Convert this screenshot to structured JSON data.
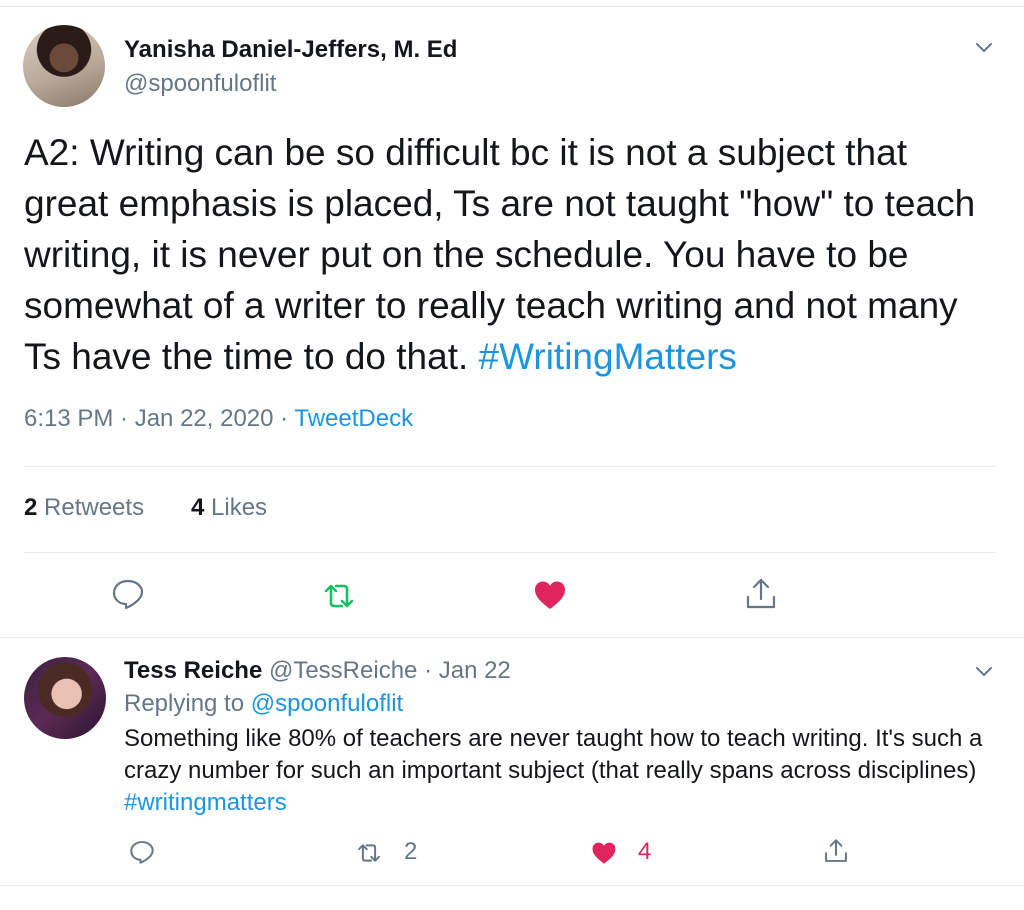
{
  "tweet": {
    "name": "Yanisha Daniel-Jeffers, M. Ed",
    "handle": "@spoonfuloflit",
    "text": "A2: Writing can be so difficult bc it is not a subject that great emphasis is placed, Ts are not taught \"how\" to teach writing, it is never put on the schedule. You have to be somewhat of a writer to really teach writing and not many Ts have the time to do that. ",
    "hashtag": "#WritingMatters",
    "time": "6:13 PM · Jan 22, 2020 · ",
    "source": "TweetDeck",
    "retweets_count": "2",
    "retweets_label": "Retweets",
    "likes_count": "4",
    "likes_label": "Likes"
  },
  "reply": {
    "name": "Tess Reiche",
    "handle": "@TessReiche",
    "date": "· Jan 22",
    "replying_label": "Replying to ",
    "replying_handle": "@spoonfuloflit",
    "text": "Something like 80% of teachers are never taught how to teach writing. It's such a crazy number for such an important subject (that really spans across disciplines) ",
    "hashtag": "#writingmatters",
    "retweet_count": "2",
    "like_count": "4"
  },
  "colors": {
    "accent": "#1b95e0",
    "like": "#e0245e",
    "retweet": "#17bf63",
    "muted": "#657786"
  },
  "icons": [
    "chevron-down-icon",
    "reply-icon",
    "retweet-icon",
    "heart-icon",
    "share-icon"
  ]
}
